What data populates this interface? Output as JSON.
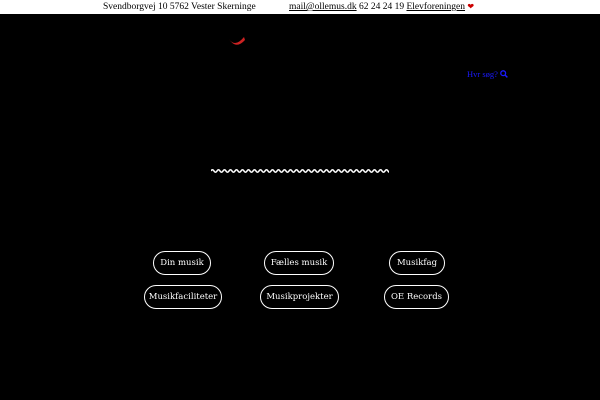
{
  "topbar": {
    "address": "Svendborgvej 10  5762 Vester Skerninge",
    "email": "mail@ollemus.dk",
    "phone": "62 24 24 19",
    "association": "Elevforeningen",
    "heart_glyph": "❤"
  },
  "search": {
    "label": "Hvr søg?",
    "icon": "search-icon"
  },
  "nav": {
    "row1": [
      "Din musik",
      "Fælles musik",
      "Musikfag"
    ],
    "row2": [
      "Musikfaciliteter",
      "Musikprojekter",
      "OE Records"
    ]
  },
  "colors": {
    "background": "#000000",
    "accent": "#cc2222",
    "link": "#1a1aff",
    "button_border": "#ffffff"
  }
}
